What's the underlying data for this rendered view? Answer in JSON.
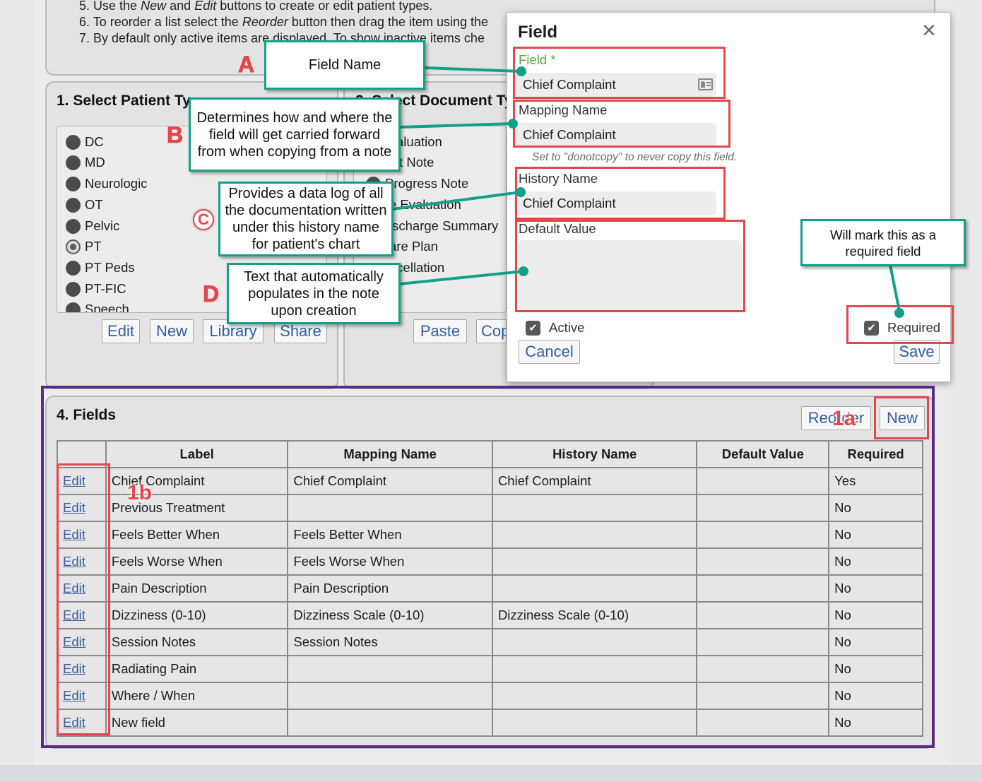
{
  "instructions": {
    "line5": {
      "num": "5.",
      "pre": "Use the",
      "new": "New",
      "and": "and",
      "edit": "Edit",
      "post": "buttons to create or edit patient types."
    },
    "line6": {
      "num": "6.",
      "pre": "To reorder a list select the",
      "reorder": "Reorder",
      "post": "button then drag the item using the"
    },
    "line7": "7. By default only active items are displayed. To show inactive items che"
  },
  "panel1": {
    "title": "1. Select Patient Ty",
    "items": [
      "DC",
      "MD",
      "Neurologic",
      "OT",
      "Pelvic",
      "PT",
      "PT Peds",
      "PT-FIC",
      "Speech"
    ],
    "selected": "PT",
    "buttons": [
      "Edit",
      "New",
      "Library",
      "Share"
    ]
  },
  "panel2": {
    "title": "2. Select Document Ty",
    "items": [
      "aluation",
      "it Note",
      "Progress Note",
      "e Evaluation",
      "ischarge Summary",
      "are Plan",
      "ncellation"
    ],
    "buttons": [
      "Paste",
      "Cop"
    ]
  },
  "fields_panel": {
    "title": "4. Fields",
    "reorder_label": "Reorder",
    "new_label": "New",
    "columns": [
      "",
      "Label",
      "Mapping Name",
      "History Name",
      "Default Value",
      "Required"
    ],
    "edit_label": "Edit",
    "rows": [
      {
        "label": "Chief Complaint",
        "mapping": "Chief Complaint",
        "history": "Chief Complaint",
        "default": "",
        "required": "Yes"
      },
      {
        "label": "Previous Treatment",
        "mapping": "",
        "history": "",
        "default": "",
        "required": "No"
      },
      {
        "label": "Feels Better When",
        "mapping": "Feels Better When",
        "history": "",
        "default": "",
        "required": "No"
      },
      {
        "label": "Feels Worse When",
        "mapping": "Feels Worse When",
        "history": "",
        "default": "",
        "required": "No"
      },
      {
        "label": "Pain Description",
        "mapping": "Pain Description",
        "history": "",
        "default": "",
        "required": "No"
      },
      {
        "label": "Dizziness (0-10)",
        "mapping": "Dizziness Scale (0-10)",
        "history": "Dizziness Scale (0-10)",
        "default": "",
        "required": "No"
      },
      {
        "label": "Session Notes",
        "mapping": "Session Notes",
        "history": "",
        "default": "",
        "required": "No"
      },
      {
        "label": "Radiating Pain",
        "mapping": "",
        "history": "",
        "default": "",
        "required": "No"
      },
      {
        "label": "Where / When",
        "mapping": "",
        "history": "",
        "default": "",
        "required": "No"
      },
      {
        "label": "New field",
        "mapping": "",
        "history": "",
        "default": "",
        "required": "No"
      }
    ]
  },
  "modal": {
    "title": "Field",
    "close": "×",
    "field_label": "Field *",
    "field_value": "Chief Complaint",
    "mapping_label": "Mapping Name",
    "mapping_value": "Chief Complaint",
    "mapping_hint": "Set to \"donotcopy\" to never copy this field.",
    "history_label": "History Name",
    "history_value": "Chief Complaint",
    "default_label": "Default Value",
    "default_value": "",
    "active_label": "Active",
    "active_checked": true,
    "required_label": "Required",
    "required_checked": true,
    "cancel_label": "Cancel",
    "save_label": "Save"
  },
  "annotations": {
    "a_letter": "A",
    "a_text": "Field Name",
    "b_letter": "B",
    "b_text": "Determines how and where the field will get carried forward from when copying from a note",
    "c_letter": "C",
    "c_text": "Provides a data log of all the documentation written under this history name for patient's chart",
    "d_letter": "D",
    "d_text": "Text that automatically populates in the note upon creation",
    "required_text": "Will mark this as a required field",
    "badge_1a": "1a",
    "badge_1b": "1b"
  },
  "colors": {
    "accent_link": "#2f5ea3",
    "callout_border": "#13a088",
    "annotation_red": "#e4464d",
    "fields_outline": "#5b2a86",
    "field_label_green": "#5aa53a"
  }
}
